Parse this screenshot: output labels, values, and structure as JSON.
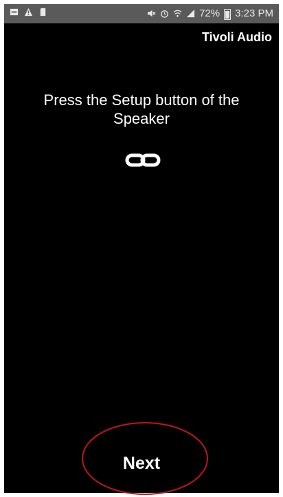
{
  "status_bar": {
    "battery": "72%",
    "time": "3:23 PM",
    "left_icons": [
      "notification-icon",
      "warning-icon",
      "sd-card-icon"
    ],
    "right_icons": [
      "mute-icon",
      "alarm-icon",
      "wifi-icon",
      "signal-icon",
      "battery-icon"
    ]
  },
  "app": {
    "title": "Tivoli Audio"
  },
  "main": {
    "instruction": "Press the Setup button of the Speaker",
    "icon": "link-icon"
  },
  "footer": {
    "next_label": "Next"
  },
  "colors": {
    "background": "#000000",
    "status_bar": "#5a5a5a",
    "annotation": "#c0151b"
  }
}
